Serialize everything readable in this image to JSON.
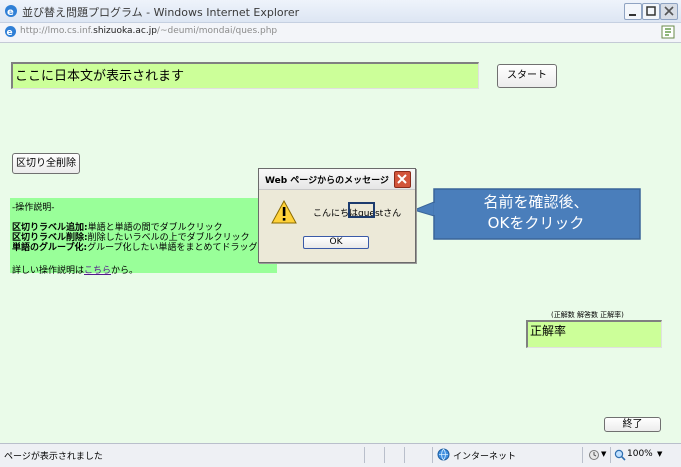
{
  "window": {
    "title": "並び替え問題プログラム - Windows Internet Explorer",
    "address_prefix": "http://lmo.cs.inf.",
    "address_host": "shizuoka.ac.jp",
    "address_path": "/~deumi/mondai/ques.php"
  },
  "page": {
    "japanese_field": "ここに日本文が表示されます",
    "start_button": "スタート",
    "clear_button": "区切り全削除",
    "help": {
      "heading": "-操作説明-",
      "line1_bold": "区切りラベル追加:",
      "line1_rest": "単語と単語の間でダブルクリック",
      "line2_bold": "区切りラベル削除:",
      "line2_rest": "削除したいラベルの上でダブルクリック",
      "line3_bold": "単語のグループ化:",
      "line3_rest": "グループ化したい単語をまとめてドラッグ",
      "line4_pre": "詳しい操作説明は",
      "line4_link": "こちら",
      "line4_post": "から。"
    },
    "score_label": "(正解数 解答数 正解率)",
    "score_field": "正解率",
    "end_button": "終了"
  },
  "dialog": {
    "title": "Web ページからのメッセージ",
    "message": "こんにちはguestさん",
    "ok_button": "OK"
  },
  "callout": {
    "line1": "名前を確認後、",
    "line2": "OKをクリック",
    "color": "#4a7ebb"
  },
  "status": {
    "text": "ページが表示されました",
    "zone": "インターネット",
    "zoom": "100%"
  }
}
